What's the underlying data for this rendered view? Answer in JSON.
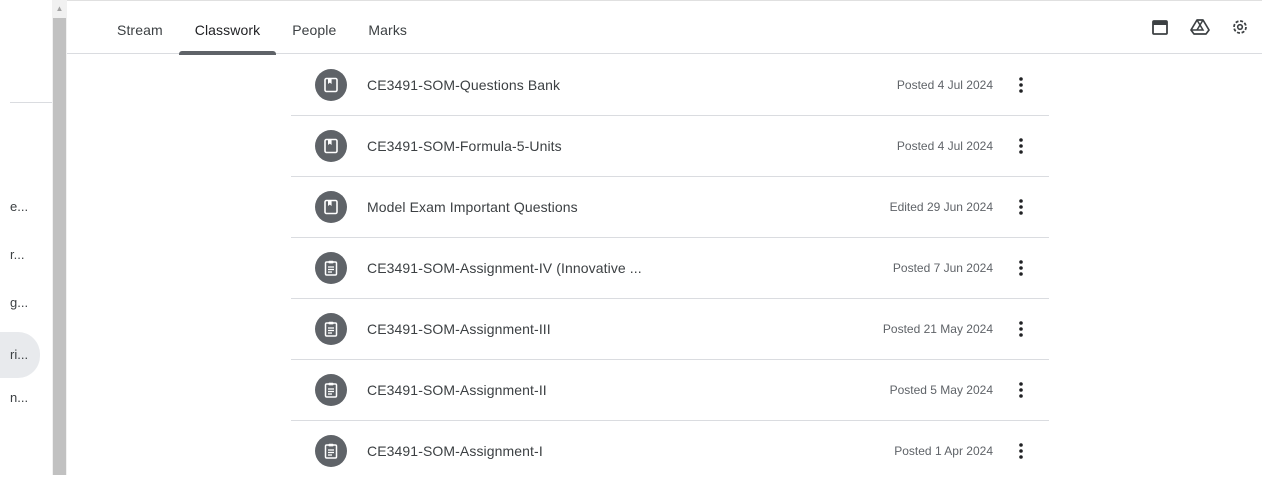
{
  "left_panel": {
    "items": [
      "e...",
      "r...",
      "g...",
      "ri...",
      "n..."
    ],
    "active_index": 3
  },
  "tabs": [
    {
      "label": "Stream",
      "active": false
    },
    {
      "label": "Classwork",
      "active": true
    },
    {
      "label": "People",
      "active": false
    },
    {
      "label": "Marks",
      "active": false
    }
  ],
  "toolbar_icons": [
    "calendar-icon",
    "drive-icon",
    "settings-icon"
  ],
  "classwork": [
    {
      "title": "CE3491-SOM-Questions Bank",
      "date": "Posted 4 Jul 2024",
      "type": "material"
    },
    {
      "title": "CE3491-SOM-Formula-5-Units",
      "date": "Posted 4 Jul 2024",
      "type": "material"
    },
    {
      "title": "Model Exam Important Questions",
      "date": "Edited 29 Jun 2024",
      "type": "material"
    },
    {
      "title": "CE3491-SOM-Assignment-IV (Innovative ...",
      "date": "Posted 7 Jun 2024",
      "type": "assignment"
    },
    {
      "title": "CE3491-SOM-Assignment-III",
      "date": "Posted 21 May 2024",
      "type": "assignment"
    },
    {
      "title": "CE3491-SOM-Assignment-II",
      "date": "Posted 5 May 2024",
      "type": "assignment"
    },
    {
      "title": "CE3491-SOM-Assignment-I",
      "date": "Posted 1 Apr 2024",
      "type": "assignment"
    }
  ],
  "colors": {
    "avatar": "#5f6368",
    "text": "#3c4043",
    "date": "#5f6368",
    "divider": "#dadce0"
  }
}
